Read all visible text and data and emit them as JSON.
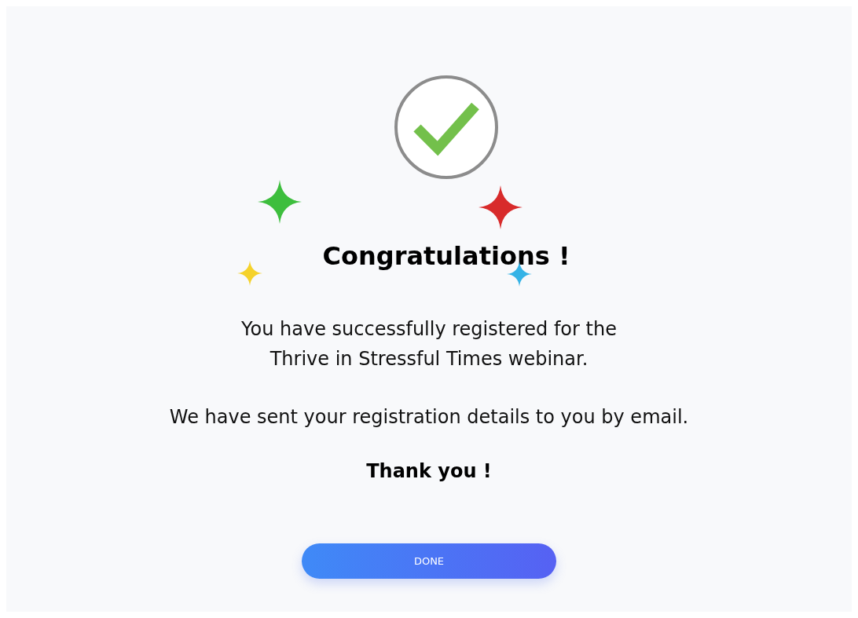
{
  "title": "Congratulations !",
  "message_lines": [
    "You have successfully registered for the",
    "Thrive in Stressful Times webinar."
  ],
  "note": "We have sent your registration details to you by email.",
  "thanks": "Thank you !",
  "button": {
    "label": "DONE"
  }
}
